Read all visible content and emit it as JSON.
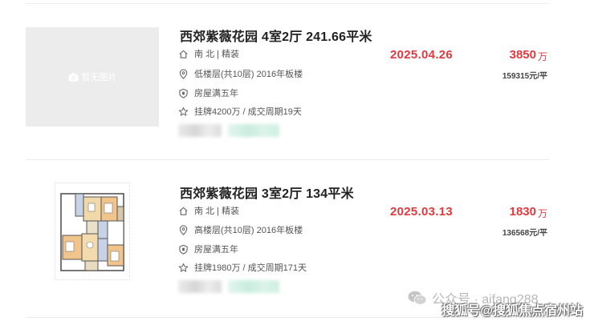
{
  "listings": [
    {
      "title": "西郊紫薇花园 4室2厅 241.66平米",
      "orientation": "南 北 | 精装",
      "floor": "低楼层(共10层) 2016年板楼",
      "tag": "房屋满五年",
      "listing_info": "挂牌4200万 / 成交周期19天",
      "deal_date": "2025.04.26",
      "total_price": "3850",
      "price_unit": "万",
      "unit_price": "159315元/平",
      "image_placeholder": "暂无图片"
    },
    {
      "title": "西郊紫薇花园 3室2厅 134平米",
      "orientation": "南 北 | 精装",
      "floor": "高楼层(共10层) 2016年板楼",
      "tag": "房屋满五年",
      "listing_info": "挂牌1980万 / 成交周期171天",
      "deal_date": "2025.03.13",
      "total_price": "1830",
      "price_unit": "万",
      "unit_price": "136568元/平"
    }
  ],
  "watermarks": {
    "wechat": "公众号 · aifang288",
    "sohu": "搜狐号@搜狐焦点宿州站"
  },
  "colors": {
    "accent_red": "#e0393e",
    "divider": "#ececec",
    "placeholder_bg": "#ececec"
  },
  "icons": {
    "house": "house-icon",
    "location": "location-pin-icon",
    "shield": "shield-icon",
    "star": "star-icon",
    "camera": "camera-icon"
  }
}
